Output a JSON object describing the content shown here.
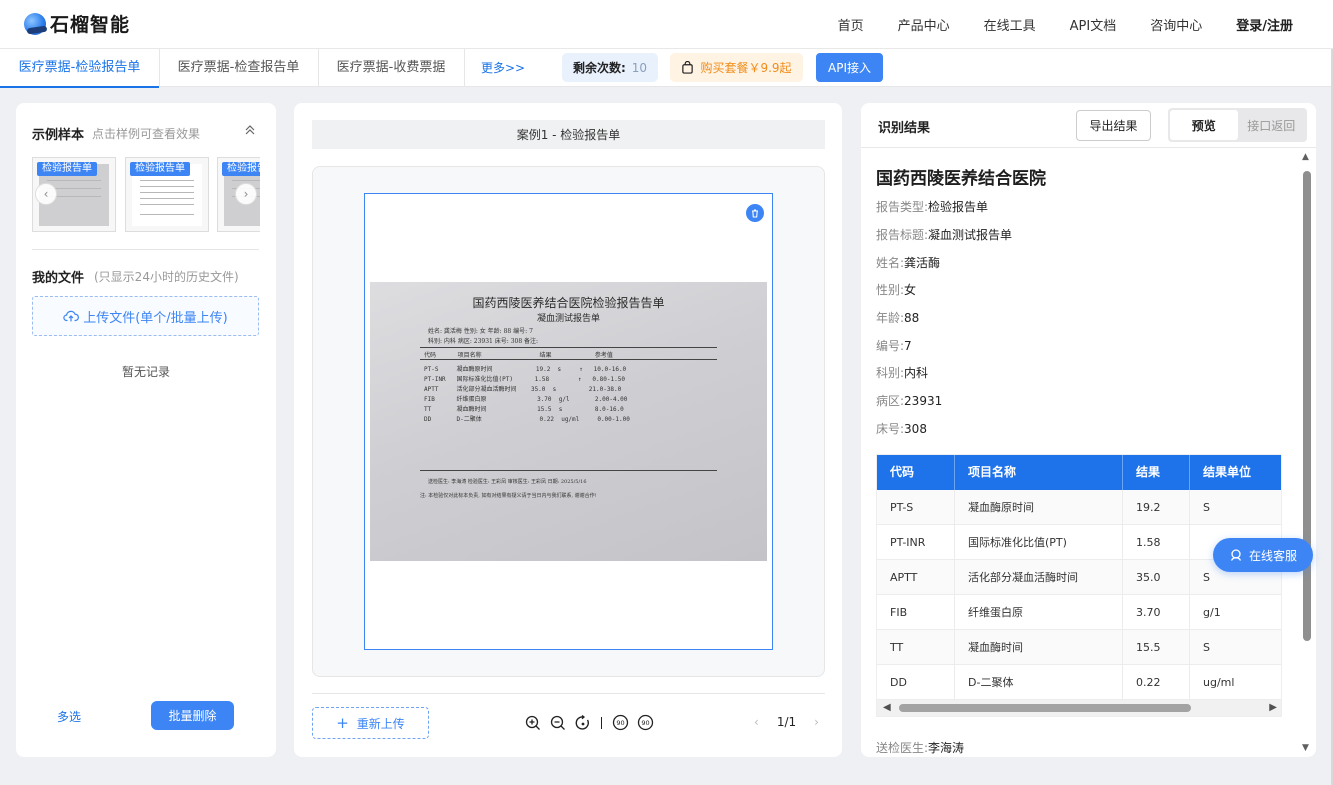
{
  "brand": {
    "name": "石榴智能"
  },
  "nav": {
    "items": [
      "首页",
      "产品中心",
      "在线工具",
      "API文档",
      "咨询中心"
    ],
    "login": "登录/注册"
  },
  "tabs": [
    {
      "label": "医疗票据-检验报告单",
      "active": true
    },
    {
      "label": "医疗票据-检查报告单",
      "active": false
    },
    {
      "label": "医疗票据-收费票据",
      "active": false
    }
  ],
  "more": "更多>>",
  "remaining": {
    "label": "剩余次数:",
    "value": "10"
  },
  "buy": {
    "label": "购买套餐￥9.9起"
  },
  "api_button": "API接入",
  "samples": {
    "title": "示例样本",
    "subtitle": "点击样例可查看效果",
    "badges": [
      "检验报告单",
      "检验报告单",
      "检验报告单"
    ]
  },
  "my_files": {
    "title": "我的文件",
    "subtitle": "(只显示24小时的历史文件)",
    "upload_label": "上传文件(单个/批量上传)",
    "empty": "暂无记录",
    "multi_select": "多选",
    "batch_delete": "批量删除"
  },
  "viewer": {
    "header": "案例1 - 检验报告单",
    "reupload": "重新上传",
    "page": "1/1"
  },
  "result": {
    "title": "识别结果",
    "export": "导出结果",
    "mode_preview": "预览",
    "mode_api": "接口返回",
    "hospital": "国药西陵医养结合医院",
    "fields": [
      {
        "label": "报告类型:",
        "value": "检验报告单"
      },
      {
        "label": "报告标题:",
        "value": "凝血测试报告单"
      },
      {
        "label": "姓名:",
        "value": "龚活酶"
      },
      {
        "label": "性别:",
        "value": "女"
      },
      {
        "label": "年龄:",
        "value": "88"
      },
      {
        "label": "编号:",
        "value": "7"
      },
      {
        "label": "科别:",
        "value": "内科"
      },
      {
        "label": "病区:",
        "value": "23931"
      },
      {
        "label": "床号:",
        "value": "308"
      }
    ],
    "table": {
      "headers": [
        "代码",
        "项目名称",
        "结果",
        "结果单位"
      ],
      "rows": [
        [
          "PT-S",
          "凝血酶原时间",
          "19.2",
          "S"
        ],
        [
          "PT-INR",
          "国际标准化比值(PT)",
          "1.58",
          ""
        ],
        [
          "APTT",
          "活化部分凝血活酶时间",
          "35.0",
          "S"
        ],
        [
          "FIB",
          "纤维蛋白原",
          "3.70",
          "g/1"
        ],
        [
          "TT",
          "凝血酶时间",
          "15.5",
          "S"
        ],
        [
          "DD",
          "D-二聚体",
          "0.22",
          "ug/ml"
        ]
      ]
    },
    "sender": {
      "label": "送检医生:",
      "value": "李海涛"
    }
  },
  "service": "在线客服",
  "photo": {
    "title": "国药西陵医养结合医院检验报告告单",
    "subtitle": "凝血测试报告单",
    "meta1": "姓名: 龚活梅     性别: 女      年龄: 88      编号: 7",
    "meta2": "科别: 内科      病区: 23931   床号: 308     备注:",
    "head": "代码      项目名称                结果            参考值",
    "rows": [
      "PT-S     凝血酶原时间            19.2  s     ↑   10.0-16.0",
      "PT-INR   国际标准化比值(PT)      1.58        ↑   0.80-1.50",
      "APTT     活化部分凝血活酶时间    35.0  s         21.0-38.0",
      "FIB      纤维蛋白原              3.70  g/l       2.00-4.00",
      "TT       凝血酶时间              15.5  s         8.0-16.0",
      "DD       D-二聚体                0.22  ug/ml     0.00-1.00"
    ],
    "foot": "送检医生: 李海涛     检验医生: 王彩凤     审核医生: 王彩凤          日期: 2025/5/16",
    "note": "注: 本检验仅对此标本负责, 如有对结果有疑义请于当日内与我们联系, 谢谢合作!"
  }
}
